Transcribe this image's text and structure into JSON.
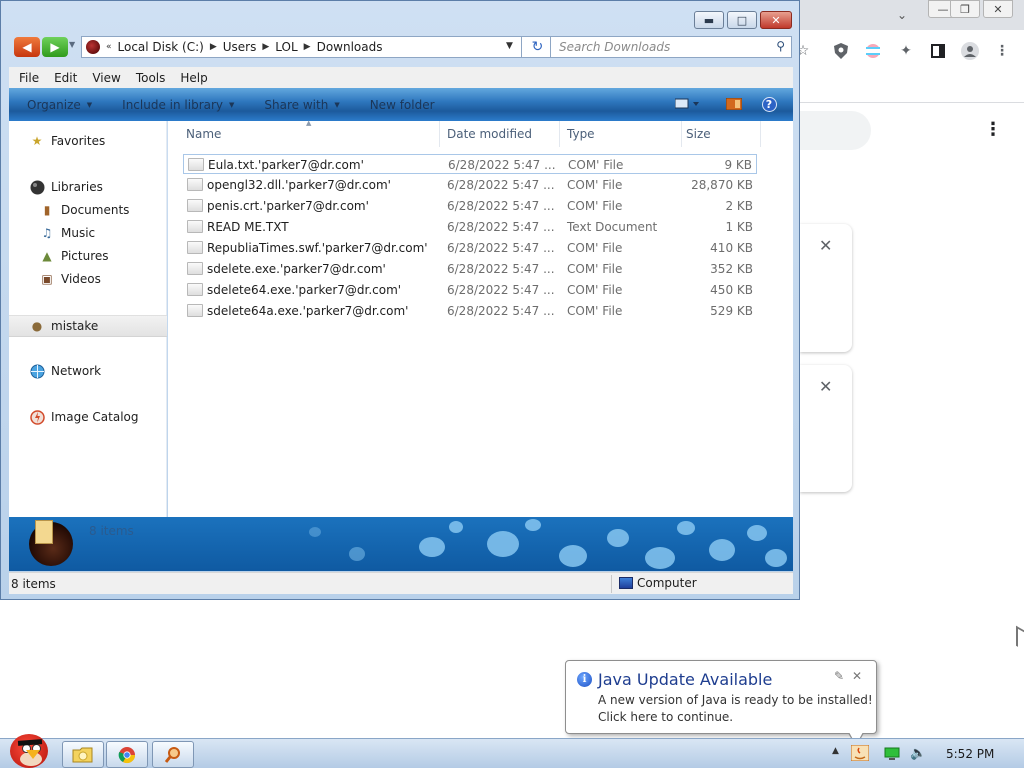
{
  "explorer": {
    "address": {
      "crumbs": [
        "Local Disk (C:)",
        "Users",
        "LOL",
        "Downloads"
      ]
    },
    "search": {
      "placeholder": "Search Downloads"
    },
    "menu": [
      "File",
      "Edit",
      "View",
      "Tools",
      "Help"
    ],
    "commands": {
      "organize": "Organize",
      "include_in_library": "Include in library",
      "share_with": "Share with",
      "new_folder": "New folder"
    },
    "nav": {
      "favorites": "Favorites",
      "libraries": "Libraries",
      "documents": "Documents",
      "music": "Music",
      "pictures": "Pictures",
      "videos": "Videos",
      "mistake": "mistake",
      "network": "Network",
      "image_catalog": "Image Catalog"
    },
    "columns": {
      "name": "Name",
      "date": "Date modified",
      "type": "Type",
      "size": "Size"
    },
    "files": [
      {
        "name": "Eula.txt.'parker7@dr.com'",
        "date": "6/28/2022 5:47 ...",
        "type": "COM' File",
        "size": "9 KB"
      },
      {
        "name": "opengl32.dll.'parker7@dr.com'",
        "date": "6/28/2022 5:47 ...",
        "type": "COM' File",
        "size": "28,870 KB"
      },
      {
        "name": "penis.crt.'parker7@dr.com'",
        "date": "6/28/2022 5:47 ...",
        "type": "COM' File",
        "size": "2 KB"
      },
      {
        "name": "READ ME.TXT",
        "date": "6/28/2022 5:47 ...",
        "type": "Text Document",
        "size": "1 KB"
      },
      {
        "name": "RepubliaTimes.swf.'parker7@dr.com'",
        "date": "6/28/2022 5:47 ...",
        "type": "COM' File",
        "size": "410 KB"
      },
      {
        "name": "sdelete.exe.'parker7@dr.com'",
        "date": "6/28/2022 5:47 ...",
        "type": "COM' File",
        "size": "352 KB"
      },
      {
        "name": "sdelete64.exe.'parker7@dr.com'",
        "date": "6/28/2022 5:47 ...",
        "type": "COM' File",
        "size": "450 KB"
      },
      {
        "name": "sdelete64a.exe.'parker7@dr.com'",
        "date": "6/28/2022 5:47 ...",
        "type": "COM' File",
        "size": "529 KB"
      }
    ],
    "details_count": "8 items",
    "status": {
      "count": "8 items",
      "location": "Computer"
    }
  },
  "java_balloon": {
    "title": "Java Update Available",
    "line1": "A new version of Java is ready to be installed!",
    "line2": "Click here to continue."
  },
  "taskbar": {
    "clock": "5:52 PM"
  },
  "colors": {
    "accent_blue": "#2f78bf",
    "java_title": "#1e3d8f",
    "close_red": "#c0392b"
  }
}
